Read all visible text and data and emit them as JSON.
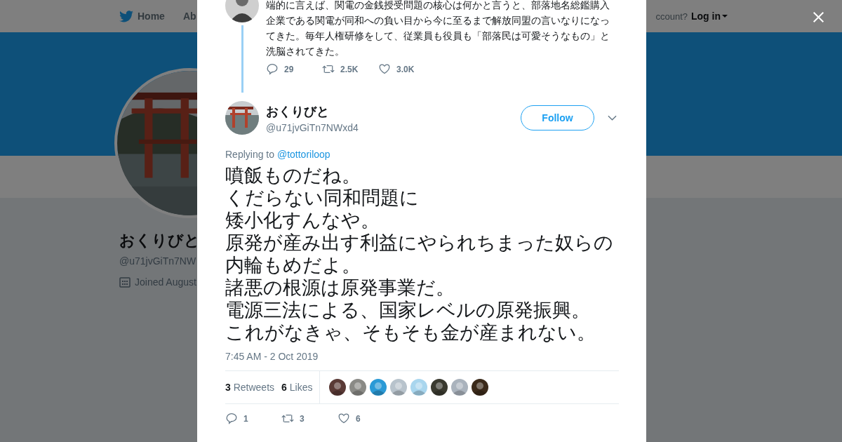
{
  "nav": {
    "items": [
      {
        "label": "Home",
        "kind": "home"
      },
      {
        "label": "Ab",
        "kind": "plain"
      }
    ],
    "account_prompt": "ccount?",
    "login": "Log in"
  },
  "profile": {
    "name": "おくりびと",
    "handle": "@u71jvGiTn7NW",
    "joined": "Joined August"
  },
  "parent_tweet": {
    "text": "端的に言えば、関電の金銭授受問題の核心は何かと言うと、部落地名総鑑購入企業である関電が同和への負い目から今に至るまで解放同盟の言いなりになってきた。毎年人権研修をして、従業員も役員も「部落民は可愛そうなもの」と洗脳されてきた。",
    "actions": [
      {
        "kind": "reply",
        "count": "29"
      },
      {
        "kind": "retweet",
        "count": "2.5K"
      },
      {
        "kind": "like",
        "count": "3.0K"
      }
    ]
  },
  "tweet": {
    "name": "おくりびと",
    "handle": "@u71jvGiTn7NWxd4",
    "follow": "Follow",
    "replying_label": "Replying to",
    "replying_to": "@tottoriloop",
    "text_lines": [
      "噴飯ものだね。",
      "くだらない同和問題に",
      "矮小化すんなや。",
      "原発が産み出す利益にやられちまった奴らの",
      "内輪もめだよ。",
      "諸悪の根源は原発事業だ。",
      "電源三法による、国家レベルの原発振興。",
      "これがなきゃ、そもそも金が産まれない。"
    ],
    "timestamp": "7:45 AM - 2 Oct 2019",
    "stats": [
      {
        "count": "3",
        "label": "Retweets"
      },
      {
        "count": "6",
        "label": "Likes"
      }
    ],
    "actions": [
      {
        "kind": "reply",
        "count": "1"
      },
      {
        "kind": "retweet",
        "count": "3"
      },
      {
        "kind": "like",
        "count": "6"
      }
    ]
  }
}
